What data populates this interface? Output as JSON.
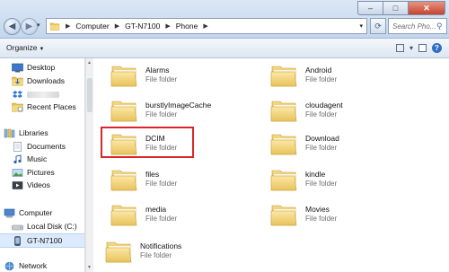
{
  "breadcrumb": [
    "Computer",
    "GT-N7100",
    "Phone"
  ],
  "search": {
    "placeholder": "Search Pho..."
  },
  "toolbar": {
    "organize_label": "Organize"
  },
  "nav": {
    "favorites": [
      {
        "label": "Desktop"
      },
      {
        "label": "Downloads"
      },
      {
        "label": ""
      },
      {
        "label": "Recent Places"
      }
    ],
    "libraries": {
      "label": "Libraries",
      "items": [
        {
          "label": "Documents"
        },
        {
          "label": "Music"
        },
        {
          "label": "Pictures"
        },
        {
          "label": "Videos"
        }
      ]
    },
    "computer": {
      "label": "Computer",
      "items": [
        {
          "label": "Local Disk (C:)"
        },
        {
          "label": "GT-N7100"
        }
      ]
    },
    "network": {
      "label": "Network"
    }
  },
  "folders": [
    {
      "name": "Alarms",
      "type": "File folder"
    },
    {
      "name": "Android",
      "type": "File folder"
    },
    {
      "name": "burstlyImageCache",
      "type": "File folder"
    },
    {
      "name": "cloudagent",
      "type": "File folder"
    },
    {
      "name": "DCIM",
      "type": "File folder"
    },
    {
      "name": "Download",
      "type": "File folder"
    },
    {
      "name": "files",
      "type": "File folder"
    },
    {
      "name": "kindle",
      "type": "File folder"
    },
    {
      "name": "media",
      "type": "File folder"
    },
    {
      "name": "Movies",
      "type": "File folder"
    },
    {
      "name": "Notifications",
      "type": "File folder"
    }
  ],
  "colors": {
    "highlight": "#d8262b",
    "folder": "#f2d27a",
    "selection": "#dcebfc"
  },
  "icons": [
    "back-icon",
    "forward-icon",
    "folder-icon",
    "refresh-icon",
    "search-icon",
    "help-icon",
    "star-icon",
    "library-icon",
    "computer-icon",
    "drive-icon",
    "phone-icon",
    "network-icon"
  ]
}
